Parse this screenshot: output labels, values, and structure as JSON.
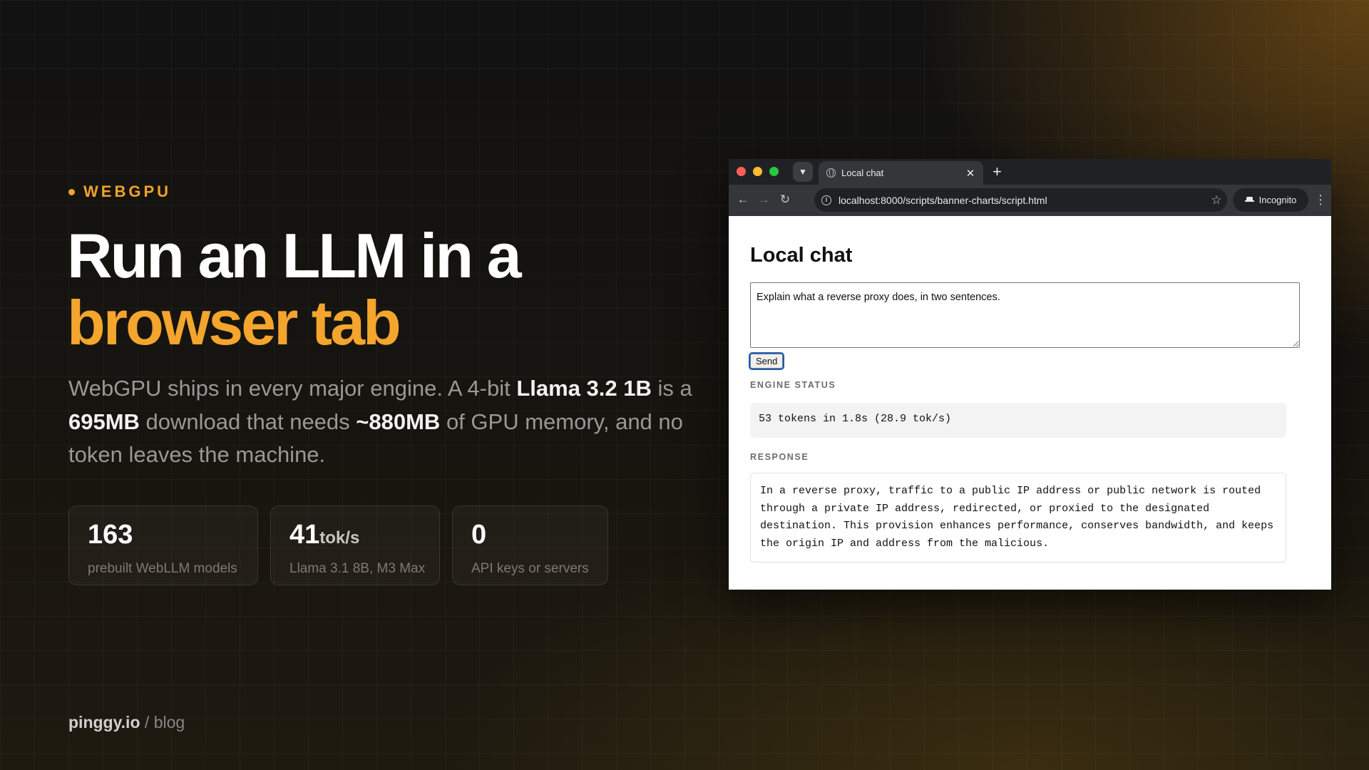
{
  "banner": {
    "eyebrow": "WEBGPU",
    "headline_line1": "Run an LLM in a",
    "headline_line2": "browser tab",
    "lede": {
      "t1": "WebGPU ships in every major engine. A 4-bit ",
      "b1": "Llama 3.2 1B",
      "t2": " is a ",
      "b2": "695MB",
      "t3": " download that needs ",
      "b3": "~880MB",
      "t4": " of GPU memory, and no token leaves the machine."
    },
    "stats": [
      {
        "value": "163",
        "unit": "",
        "caption": "prebuilt WebLLM models"
      },
      {
        "value": "41",
        "unit": "tok/s",
        "caption": "Llama 3.1 8B, M3 Max"
      },
      {
        "value": "0",
        "unit": "",
        "caption": "API keys or servers"
      }
    ],
    "footer": {
      "site": "pinggy.io",
      "sep": " / ",
      "section": "blog"
    }
  },
  "browser": {
    "tab_title": "Local chat",
    "url": "localhost:8000/scripts/banner-charts/script.html",
    "incognito_label": "Incognito",
    "icons": {
      "tab_search": "chevron-down-icon",
      "favicon": "globe-icon",
      "close": "close-icon",
      "new_tab": "plus-icon",
      "back": "arrow-left-icon",
      "forward": "arrow-right-icon",
      "reload": "reload-icon",
      "site_info": "info-icon",
      "bookmark": "star-icon",
      "incognito": "incognito-icon",
      "menu": "more-vert-icon"
    },
    "colors": {
      "close": "#ff5f57",
      "minimize": "#febc2e",
      "maximize": "#28c840"
    }
  },
  "chat": {
    "title": "Local chat",
    "prompt_value": "Explain what a reverse proxy does, in two sentences.",
    "send_label": "Send",
    "status_label": "ENGINE STATUS",
    "status_text": "53 tokens in 1.8s (28.9 tok/s)",
    "response_label": "RESPONSE",
    "response_text": "In a reverse proxy, traffic to a public IP address or public network is routed through a private IP address, redirected, or proxied to the designated destination. This provision enhances performance, conserves bandwidth, and keeps the origin IP and address from the malicious."
  },
  "theme": {
    "accent": "#f4a52d",
    "background": "#1a1510"
  }
}
